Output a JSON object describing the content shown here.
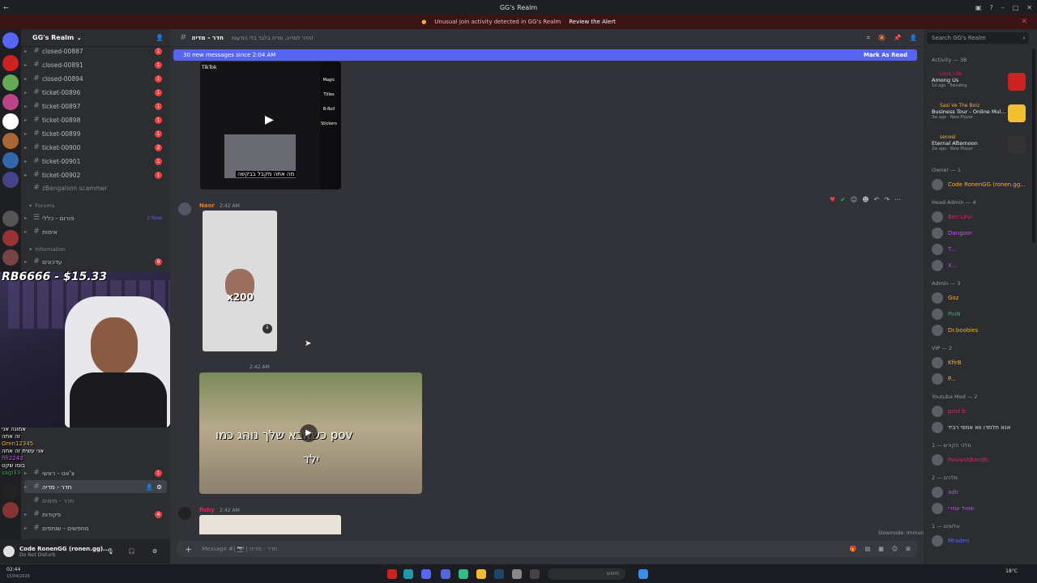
{
  "window": {
    "title": "GG's Realm"
  },
  "alert": {
    "text": "Unusual join activity detected in GG's Realm",
    "action": "Review the Alert"
  },
  "server": {
    "name": "GG's Realm"
  },
  "channels": [
    {
      "name": "closed-00887",
      "badge": "1"
    },
    {
      "name": "closed-00891",
      "badge": "1"
    },
    {
      "name": "closed-00894",
      "badge": "1"
    },
    {
      "name": "ticket-00896",
      "badge": "1"
    },
    {
      "name": "ticket-00897",
      "badge": "1"
    },
    {
      "name": "ticket-00898",
      "badge": "1"
    },
    {
      "name": "ticket-00899",
      "badge": "1"
    },
    {
      "name": "ticket-00900",
      "badge": "2"
    },
    {
      "name": "ticket-00901",
      "badge": "1"
    },
    {
      "name": "ticket-00902",
      "badge": "1"
    }
  ],
  "extra_channel": "zBengalson scammer",
  "categories": {
    "forums": "Forums",
    "information": "Information"
  },
  "forum_channels": [
    {
      "name": "פורום - כללי",
      "tag": "2 New"
    },
    {
      "name": "אימות"
    },
    {
      "name": "עדכונים"
    }
  ],
  "stream_overlay": {
    "donation": "RB6666 - $15.33",
    "multiplier": "x200"
  },
  "chat_overlay": [
    "אמונה אני",
    "זה אתה",
    "Oren12345",
    "אני עשית זה אתה",
    "fifi2243",
    "בוסו שקט",
    "sagi33"
  ],
  "lower_channels": [
    {
      "name": "צ'אט - ראשי",
      "badge": "1"
    },
    {
      "name": "חדר - מדיה",
      "active": true
    },
    {
      "name": "חדר - מימים"
    },
    {
      "name": "פקודות",
      "badge": "4"
    },
    {
      "name": "מחפשים - שותפים"
    }
  ],
  "user": {
    "name": "Code RonenGG (ronen.gg)...",
    "status": "Do Not Disturb"
  },
  "channel_header": {
    "name": "חדר - מדיה",
    "topic": "חדר למדיה, מדיה בלבד בלי הודעות!"
  },
  "new_messages": {
    "text": "30 new messages since 2:04 AM",
    "action": "Mark As Read"
  },
  "messages": [
    {
      "author": "Naor",
      "time": "2:42 AM"
    },
    {
      "author": "",
      "time": "2:42 AM",
      "caption1": "כשאבא שלך נוהג כמו pov",
      "caption2": "ילד"
    },
    {
      "author": "fishy",
      "time": "2:42 AM"
    }
  ],
  "video_top": {
    "caption": "מה אתה מקבל בבקשה",
    "tool1": "Magic",
    "tool2": "Titles",
    "tool3": "B-Roll",
    "tool4": "Stickers",
    "app": "TikTok"
  },
  "slowmode": "Slowmode: Immune",
  "message_input": {
    "placeholder": "Message #| 📷 | חדר - מדיה"
  },
  "search": {
    "placeholder": "Search GG's Realm"
  },
  "activity": {
    "title": "Activity — 38",
    "items": [
      {
        "user": "Liors Life",
        "game": "Among Us",
        "meta": "1d ago · Trending"
      },
      {
        "user": "Sasi Ve The Boiz",
        "game": "Business Tour - Online Mul...",
        "meta": "3w ago · New Player"
      },
      {
        "user": "senoel",
        "game": "Eternal Afternoon",
        "meta": "2w ago · New Player"
      }
    ]
  },
  "member_groups": [
    {
      "title": "Owner — 1",
      "members": [
        {
          "name": "Code RonenGG (ronen.gg...",
          "color": "#f0b232"
        }
      ]
    },
    {
      "title": "Head Admin — 4",
      "members": [
        {
          "name": "Ben Levi",
          "color": "#e91e63"
        },
        {
          "name": "Dangoor",
          "color": "#c44ff0"
        },
        {
          "name": "T...",
          "color": "#c44ff0"
        },
        {
          "name": "X...",
          "color": "#c44ff0"
        }
      ]
    },
    {
      "title": "Admin — 3",
      "members": [
        {
          "name": "Goz",
          "color": "#f0b232"
        },
        {
          "name": "PaIN",
          "color": "#3ba55d"
        },
        {
          "name": "Dr.boobies",
          "color": "#f0b232"
        }
      ]
    },
    {
      "title": "VIP — 2",
      "members": [
        {
          "name": "KfirB",
          "color": "#f0b232"
        },
        {
          "name": "P...",
          "color": "#f0b232"
        }
      ]
    },
    {
      "title": "Youtuba Mod — 2",
      "members": [
        {
          "name": "post b",
          "color": "#e91e63"
        },
        {
          "name": "אנא תלמדו ווא אמפי רביד",
          "color": "#dbdee1"
        }
      ]
    },
    {
      "title": "מלכי הקודש — 1",
      "members": [
        {
          "name": "PasivaXBandit",
          "color": "#e91e63"
        }
      ]
    },
    {
      "title": "מלכים — 2",
      "members": [
        {
          "name": "adir",
          "color": "#c44ff0"
        },
        {
          "name": "שאול עמרי",
          "color": "#c44ff0"
        }
      ]
    },
    {
      "title": "אלופים — 1",
      "members": [
        {
          "name": "Mraden",
          "color": "#5865f2"
        }
      ]
    }
  ],
  "taskbar": {
    "time": "02:44",
    "date": "15/04/2026",
    "weather": "18°C",
    "search": "חיפוש"
  }
}
